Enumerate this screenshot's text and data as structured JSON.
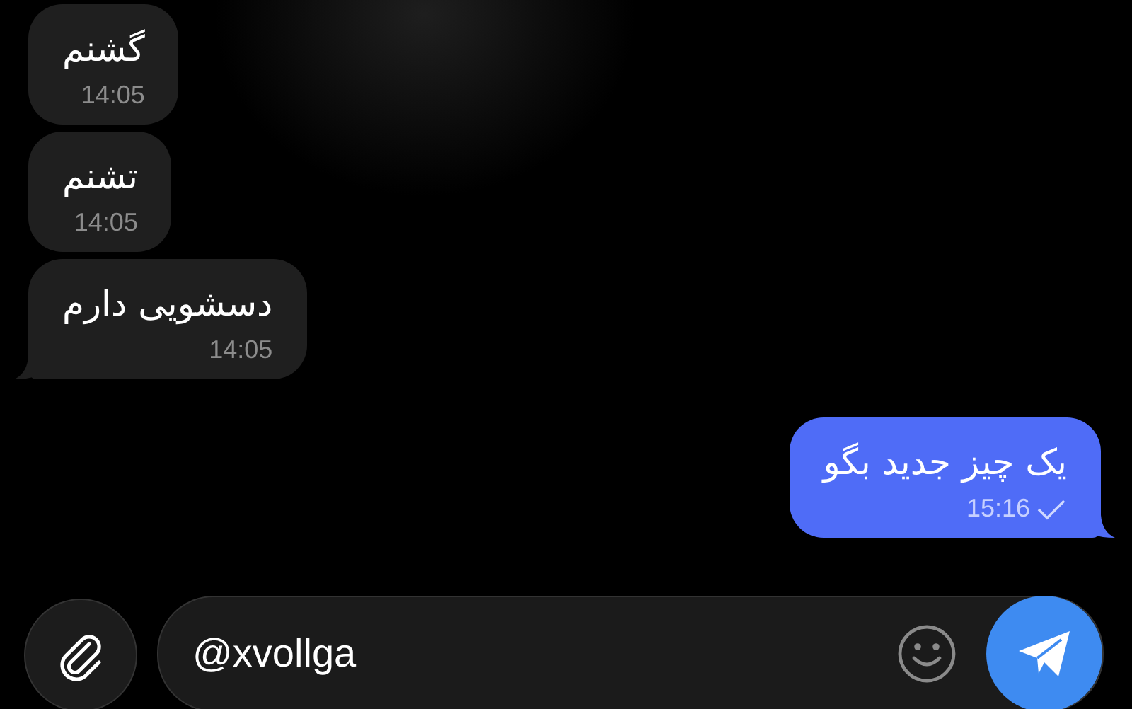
{
  "messages": [
    {
      "kind": "incoming",
      "text": "گشنم",
      "time": "14:05",
      "tail": false
    },
    {
      "kind": "incoming",
      "text": "تشنم",
      "time": "14:05",
      "tail": false
    },
    {
      "kind": "incoming",
      "text": "دسشویی دارم",
      "time": "14:05",
      "tail": true
    },
    {
      "kind": "outgoing",
      "text": "یک چیز جدید بگو",
      "time": "15:16",
      "tail": true,
      "read": false
    }
  ],
  "composer": {
    "value": "@xvollga"
  }
}
